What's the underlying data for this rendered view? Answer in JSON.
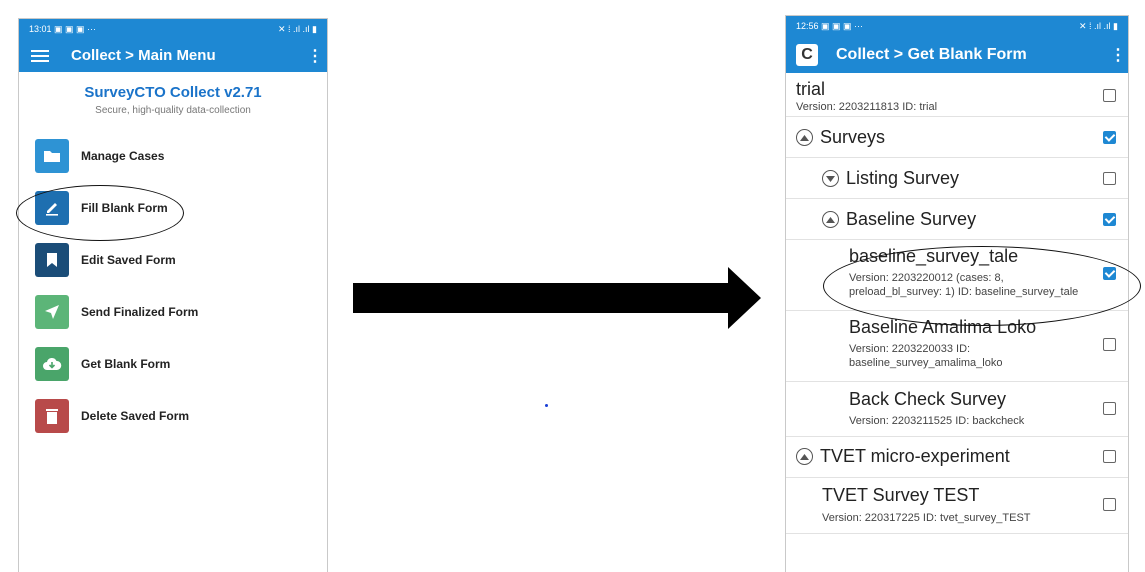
{
  "left_screen": {
    "status_time": "13:01",
    "status_left_icons": "▣ ▣ ▣ ···",
    "status_right_icons": "✕ ⁞ .ıl .ıl ▮",
    "appbar_title": "Collect > Main Menu",
    "brand_name": "SurveyCTO Collect v2.71",
    "brand_tagline": "Secure, high-quality data-collection",
    "menu": [
      {
        "label": "Manage Cases",
        "icon": "folder-icon",
        "color": "#2e93d4"
      },
      {
        "label": "Fill Blank Form",
        "icon": "edit-icon",
        "color": "#1e6fb0"
      },
      {
        "label": "Edit Saved Form",
        "icon": "bookmark-icon",
        "color": "#1b4d78"
      },
      {
        "label": "Send Finalized Form",
        "icon": "send-icon",
        "color": "#5cb578"
      },
      {
        "label": "Get Blank Form",
        "icon": "cloud-download-icon",
        "color": "#4aa56a"
      },
      {
        "label": "Delete Saved Form",
        "icon": "trash-icon",
        "color": "#b84a4a"
      }
    ]
  },
  "right_screen": {
    "status_time": "12:56",
    "status_left_icons": "▣ ▣ ▣ ···",
    "status_right_icons": "✕ ⁞ .ıl .ıl ▮",
    "appbar_logo": "C",
    "appbar_title": "Collect > Get Blank Form",
    "rows": [
      {
        "kind": "form",
        "title": "trial",
        "version": "Version: 2203211813 ID: trial",
        "checked": false
      },
      {
        "kind": "group",
        "title": "Surveys",
        "expanded": true,
        "checked": true
      },
      {
        "kind": "group",
        "title": "Listing Survey",
        "expanded": false,
        "checked": false
      },
      {
        "kind": "group",
        "title": "Baseline Survey",
        "expanded": true,
        "checked": true
      },
      {
        "kind": "form",
        "title": "baseline_survey_tale",
        "version": "Version: 2203220012 (cases: 8,",
        "version2": "preload_bl_survey: 1) ID: baseline_survey_tale",
        "checked": true
      },
      {
        "kind": "form",
        "title": "Baseline Amalima Loko",
        "version": "Version: 2203220033 ID:",
        "version2": "baseline_survey_amalima_loko",
        "checked": false
      },
      {
        "kind": "form",
        "title": "Back Check Survey",
        "version": "Version: 2203211525 ID: backcheck",
        "checked": false
      },
      {
        "kind": "group",
        "title": "TVET micro-experiment",
        "expanded": true,
        "checked": false
      },
      {
        "kind": "form",
        "title": "TVET Survey TEST",
        "version": "Version: 220317225 ID: tvet_survey_TEST",
        "checked": false
      }
    ]
  },
  "colors": {
    "accent": "#1e88d3",
    "brand_text": "#1a73c9"
  }
}
